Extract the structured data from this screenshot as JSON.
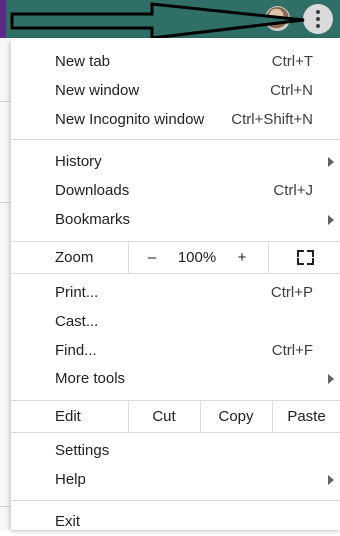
{
  "menu": {
    "group1": [
      {
        "label": "New tab",
        "shortcut": "Ctrl+T"
      },
      {
        "label": "New window",
        "shortcut": "Ctrl+N"
      },
      {
        "label": "New Incognito window",
        "shortcut": "Ctrl+Shift+N"
      }
    ],
    "group2": [
      {
        "label": "History",
        "shortcut": ""
      },
      {
        "label": "Downloads",
        "shortcut": "Ctrl+J"
      },
      {
        "label": "Bookmarks",
        "shortcut": ""
      }
    ],
    "zoom": {
      "label": "Zoom",
      "minus": "–",
      "value": "100%",
      "plus": "+"
    },
    "group3": [
      {
        "label": "Print...",
        "shortcut": "Ctrl+P"
      },
      {
        "label": "Cast...",
        "shortcut": ""
      },
      {
        "label": "Find...",
        "shortcut": "Ctrl+F"
      },
      {
        "label": "More tools",
        "shortcut": ""
      }
    ],
    "edit": {
      "label": "Edit",
      "cut": "Cut",
      "copy": "Copy",
      "paste": "Paste"
    },
    "group4": [
      {
        "label": "Settings",
        "shortcut": ""
      },
      {
        "label": "Help",
        "shortcut": ""
      }
    ],
    "exit": {
      "label": "Exit"
    }
  },
  "icons": {
    "fullscreen": "fullscreen-icon",
    "kebab": "more-vert-icon",
    "submenu": "chevron-right-icon",
    "arrow_annotation": "arrow-right-icon"
  },
  "colors": {
    "toolbar": "#2f6f68",
    "separator": "#dadce0",
    "text": "#202124"
  }
}
